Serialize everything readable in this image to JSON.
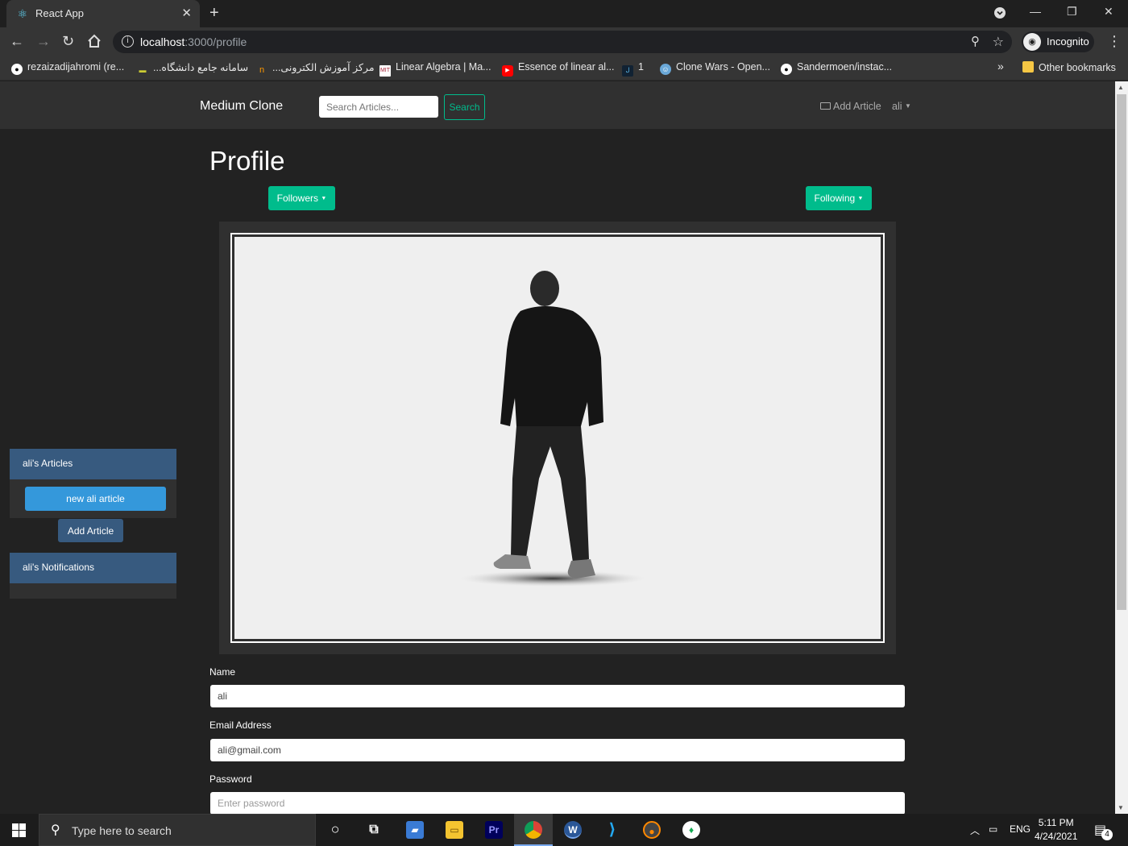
{
  "browser": {
    "tab_title": "React App",
    "url_host": "localhost",
    "url_path": ":3000/profile",
    "incognito_label": "Incognito",
    "bookmarks": [
      "rezaizadijahromi (re...",
      "...سامانه جامع دانشگاه",
      "...مرکز آموزش الکترونی",
      "Linear Algebra | Ma...",
      "Essence of linear al...",
      "1",
      "Clone Wars - Open...",
      "Sandermoen/instac..."
    ],
    "more_bookmarks": "»",
    "other_bookmarks": "Other bookmarks"
  },
  "navbar": {
    "brand": "Medium Clone",
    "search_placeholder": "Search Articles...",
    "search_button": "Search",
    "add_article": "Add Article",
    "user": "ali"
  },
  "profile": {
    "title": "Profile",
    "followers_button": "Followers",
    "following_button": "Following"
  },
  "sidebar": {
    "articles_header": "ali's Articles",
    "articles": [
      "new ali article"
    ],
    "add_article_button": "Add Article",
    "notifications_header": "ali's Notifications"
  },
  "form": {
    "name_label": "Name",
    "name_value": "ali",
    "email_label": "Email Address",
    "email_value": "ali@gmail.com",
    "password_label": "Password",
    "password_placeholder": "Enter password"
  },
  "taskbar": {
    "search_placeholder": "Type here to search",
    "language": "ENG",
    "time": "5:11 PM",
    "date": "4/24/2021",
    "notification_count": "4"
  },
  "colors": {
    "accent": "#00bc8c",
    "primary": "#375a7f",
    "info": "#3498db",
    "background": "#222222",
    "navbar": "#303030"
  }
}
